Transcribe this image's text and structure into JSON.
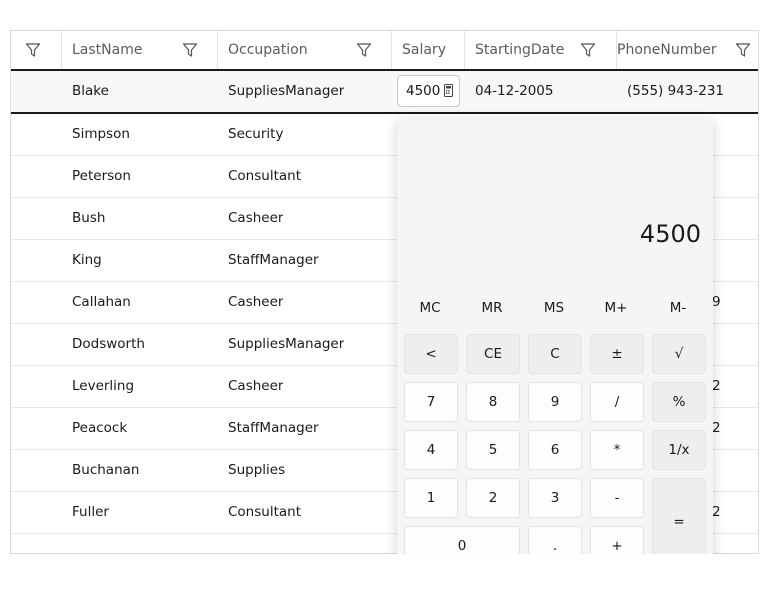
{
  "columns": [
    {
      "label": ""
    },
    {
      "label": "LastName"
    },
    {
      "label": "Occupation"
    },
    {
      "label": "Salary"
    },
    {
      "label": "StartingDate"
    },
    {
      "label": "PhoneNumber"
    }
  ],
  "selected_row": {
    "last_name": "Blake",
    "occupation": "SuppliesManager",
    "salary_value": "4500",
    "starting_date": "04-12-2005",
    "phone": "(555) 943-231"
  },
  "rows": [
    {
      "last_name": "Simpson",
      "occupation": "Security",
      "phone_tail": ""
    },
    {
      "last_name": "Peterson",
      "occupation": "Consultant",
      "phone_tail": ""
    },
    {
      "last_name": "Bush",
      "occupation": "Casheer",
      "phone_tail": ""
    },
    {
      "last_name": "King",
      "occupation": "StaffManager",
      "phone_tail": ""
    },
    {
      "last_name": "Callahan",
      "occupation": "Casheer",
      "phone_tail": "9"
    },
    {
      "last_name": "Dodsworth",
      "occupation": "SuppliesManager",
      "phone_tail": ""
    },
    {
      "last_name": "Leverling",
      "occupation": "Casheer",
      "phone_tail": "2"
    },
    {
      "last_name": "Peacock",
      "occupation": "StaffManager",
      "phone_tail": "2"
    },
    {
      "last_name": "Buchanan",
      "occupation": "Supplies",
      "phone_tail": ""
    },
    {
      "last_name": "Fuller",
      "occupation": "Consultant",
      "phone_tail": "2"
    }
  ],
  "calculator": {
    "display": "4500",
    "memory": [
      "MC",
      "MR",
      "MS",
      "M+",
      "M-"
    ],
    "keys": {
      "back": "<",
      "ce": "CE",
      "c": "C",
      "plusminus": "±",
      "sqrt": "√",
      "k7": "7",
      "k8": "8",
      "k9": "9",
      "div": "/",
      "pct": "%",
      "k4": "4",
      "k5": "5",
      "k6": "6",
      "mul": "*",
      "inv": "1/x",
      "k1": "1",
      "k2": "2",
      "k3": "3",
      "sub": "-",
      "eq": "=",
      "k0": "0",
      "dot": ".",
      "add": "+"
    }
  }
}
